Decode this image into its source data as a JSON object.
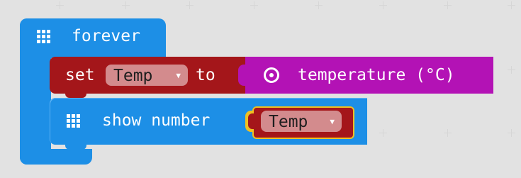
{
  "blocks": {
    "forever": {
      "label": "forever",
      "icon": "grid-icon",
      "color": "#1d8fe6"
    },
    "set": {
      "label_set": "set",
      "label_to": "to",
      "variable": "Temp",
      "color": "#a4161a"
    },
    "temperature": {
      "label": "temperature (°C)",
      "icon": "target-icon",
      "color": "#b312b5"
    },
    "show_number": {
      "label": "show number",
      "variable": "Temp",
      "icon": "grid-icon",
      "color": "#1d8fe6"
    }
  },
  "dropdown_arrow": "▼"
}
